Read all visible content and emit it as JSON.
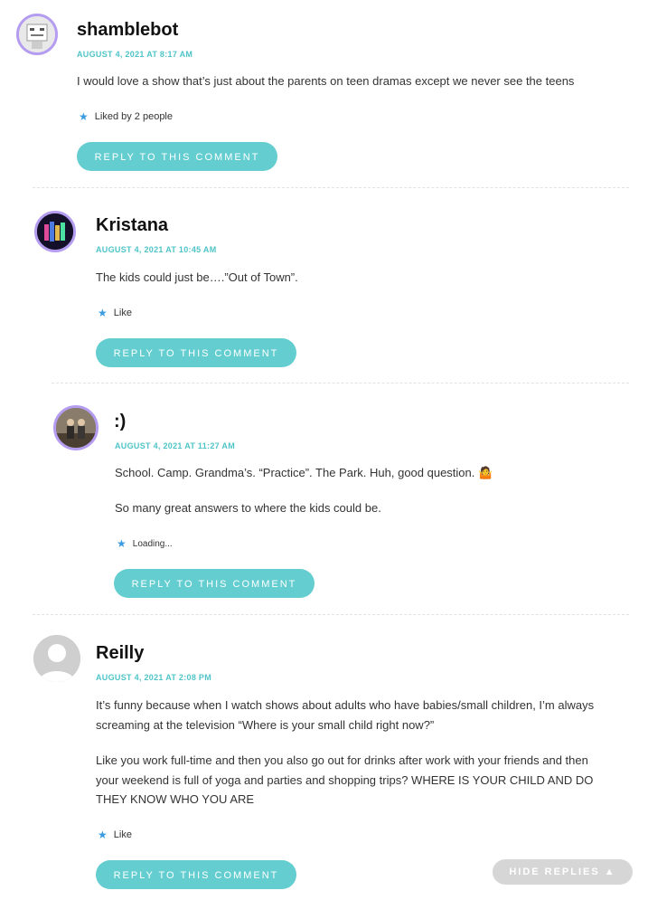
{
  "comments": [
    {
      "author": "shamblebot",
      "date": "AUGUST 4, 2021 AT 8:17 AM",
      "paragraphs": [
        "I would love a show that’s just about the parents on teen dramas except we never see the teens"
      ],
      "like_text": "Liked by 2 people",
      "reply_label": "REPLY TO THIS COMMENT"
    },
    {
      "author": "Kristana",
      "date": "AUGUST 4, 2021 AT 10:45 AM",
      "paragraphs": [
        "The kids could just be….”Out of Town”."
      ],
      "like_text": "Like",
      "reply_label": "REPLY TO THIS COMMENT"
    },
    {
      "author": ":)",
      "date": "AUGUST 4, 2021 AT 11:27 AM",
      "paragraphs": [
        "School. Camp. Grandma’s. “Practice”. The Park. Huh, good question. 🤷",
        "So many great answers to where the kids could be."
      ],
      "like_text": "Loading...",
      "reply_label": "REPLY TO THIS COMMENT"
    },
    {
      "author": "Reilly",
      "date": "AUGUST 4, 2021 AT 2:08 PM",
      "paragraphs": [
        "It’s funny because when I watch shows about adults who have babies/small children, I’m always",
        "screaming at the television “Where is your small child right now?”",
        "Like you work full-time and then you also go out for drinks after work with your friends and then",
        "your weekend is full of yoga and parties and shopping trips? WHERE IS YOUR CHILD AND DO",
        "THEY KNOW WHO YOU ARE"
      ],
      "like_text": "Like",
      "reply_label": "REPLY TO THIS COMMENT"
    }
  ],
  "hide_replies_label": "HIDE REPLIES ▲",
  "colors": {
    "accent": "#63cdd0",
    "date": "#4fc4c8",
    "star": "#3a9be0",
    "avatar_border": "#b49cf0",
    "hide_button": "#d6d6d6"
  }
}
